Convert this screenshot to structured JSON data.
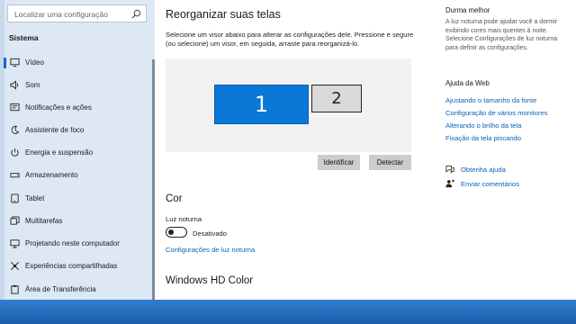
{
  "sidebar": {
    "search_placeholder": "Localizar uma configuração",
    "section_title": "Sistema",
    "items": [
      {
        "label": "Vídeo",
        "icon": "monitor-icon",
        "selected": true
      },
      {
        "label": "Som",
        "icon": "speaker-icon"
      },
      {
        "label": "Notificações e ações",
        "icon": "notification-icon"
      },
      {
        "label": "Assistente de foco",
        "icon": "moon-icon"
      },
      {
        "label": "Energia e suspensão",
        "icon": "power-icon"
      },
      {
        "label": "Armazenamento",
        "icon": "storage-icon"
      },
      {
        "label": "Tablet",
        "icon": "tablet-icon"
      },
      {
        "label": "Multitarefas",
        "icon": "multitask-icon"
      },
      {
        "label": "Projetando neste computador",
        "icon": "projector-icon"
      },
      {
        "label": "Experiências compartilhadas",
        "icon": "share-icon"
      },
      {
        "label": "Área de Transferência",
        "icon": "clipboard-icon"
      }
    ]
  },
  "main": {
    "title": "Reorganizar suas telas",
    "description": "Selecione um visor abaixo para alterar as configurações dele. Pressione e segure (ou selecione) um visor, em seguida, arraste para reorganizá-lo.",
    "monitor1": "1",
    "monitor2": "2",
    "identify_button": "Identificar",
    "detect_button": "Detectar",
    "color_heading": "Cor",
    "night_light_label": "Luz noturna",
    "night_light_state": "Desativado",
    "night_light_link": "Configurações de luz noturna",
    "hd_color_heading": "Windows HD Color"
  },
  "right": {
    "sleep_title": "Durma melhor",
    "sleep_desc": "A luz noturna pode ajudar você a dormir exibindo cores mais quentes à noite. Selecione Configurações de luz noturna para definir as configurações.",
    "help_title": "Ajuda da Web",
    "help_links": [
      "Ajustando o tamanho da fonte",
      "Configuração de vários monitores",
      "Alterando o brilho da tela",
      "Fixação da tela piscando"
    ],
    "get_help": "Obtenha ajuda",
    "feedback": "Enviar comentários"
  },
  "colors": {
    "accent": "#0b78d7",
    "link": "#0b62b9",
    "sidebar_bg": "#dde8f4"
  }
}
